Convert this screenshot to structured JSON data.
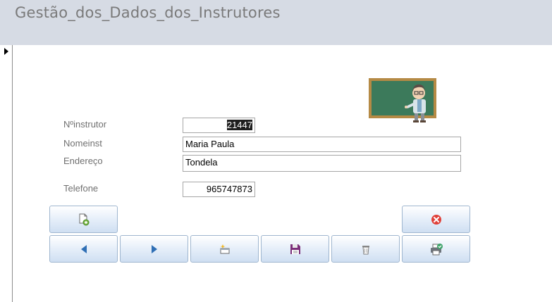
{
  "form": {
    "title": "Gestão_dos_Dados_dos_Instrutores"
  },
  "fields": {
    "ninstrutor": {
      "label": "Nºinstrutor",
      "value": "21447"
    },
    "nomeinst": {
      "label": "Nomeinst",
      "value": "Maria Paula"
    },
    "endereco": {
      "label": "Endereço",
      "value": "Tondela"
    },
    "telefone": {
      "label": "Telefone",
      "value": "965747873"
    }
  },
  "icons": {
    "logo": "teacher-chalkboard-icon",
    "new_record": "new-record-icon",
    "close": "close-icon",
    "previous": "previous-record-icon",
    "next": "next-record-icon",
    "add": "add-record-icon",
    "save": "save-icon",
    "delete": "trash-icon",
    "print": "print-icon"
  },
  "colors": {
    "header_bg": "#d6dbe4",
    "button_border": "#9fb6cf",
    "close_red": "#e0413a",
    "arrow_blue": "#2f6fb5"
  }
}
